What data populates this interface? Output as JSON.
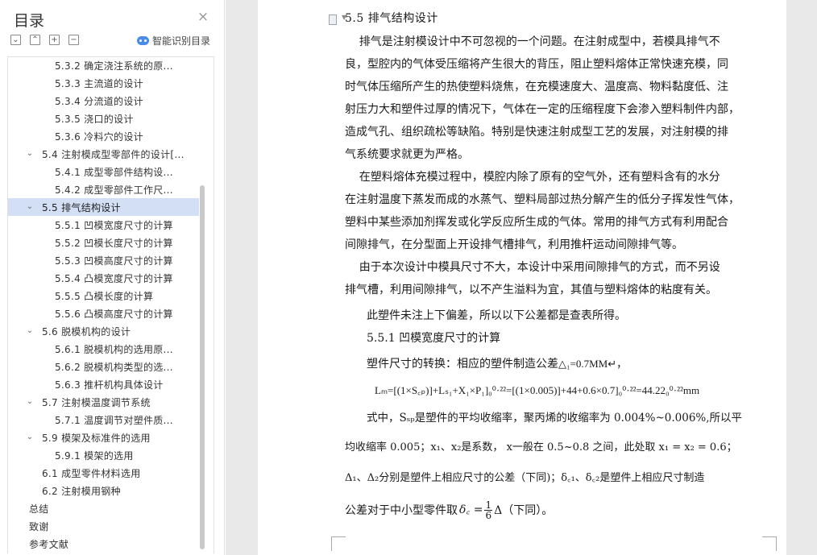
{
  "nav": {
    "title": "目录",
    "close_glyph": "×",
    "toolbar": {
      "collapse_glyph": "⌄",
      "expand_glyph": "⌃",
      "add_glyph": "+",
      "remove_glyph": "−",
      "smart_label": "智能识别目录"
    },
    "items": [
      {
        "label": "5.3.2  确定浇注系统的原...",
        "level": 3,
        "arrow": ""
      },
      {
        "label": "5.3.3  主流道的设计",
        "level": 3,
        "arrow": ""
      },
      {
        "label": "5.3.4  分流道的设计",
        "level": 3,
        "arrow": ""
      },
      {
        "label": "5.3.5  浇口的设计",
        "level": 3,
        "arrow": ""
      },
      {
        "label": "5.3.6  冷料穴的设计",
        "level": 3,
        "arrow": ""
      },
      {
        "label": "5.4  注射模成型零部件的设计[...",
        "level": 2,
        "arrow": "⌄"
      },
      {
        "label": "5.4.1  成型零部件结构设...",
        "level": 3,
        "arrow": ""
      },
      {
        "label": "5.4.2  成型零部件工作尺...",
        "level": 3,
        "arrow": ""
      },
      {
        "label": "5.5  排气结构设计",
        "level": 2,
        "arrow": "⌄",
        "selected": true
      },
      {
        "label": "5.5.1 凹模宽度尺寸的计算",
        "level": 3,
        "arrow": ""
      },
      {
        "label": "5.5.2 凹模长度尺寸的计算",
        "level": 3,
        "arrow": ""
      },
      {
        "label": "5.5.3 凹模高度尺寸的计算",
        "level": 3,
        "arrow": ""
      },
      {
        "label": "5.5.4 凸模宽度尺寸的计算",
        "level": 3,
        "arrow": ""
      },
      {
        "label": "5.5.5 凸模长度的计算",
        "level": 3,
        "arrow": ""
      },
      {
        "label": "5.5.6 凸模高度尺寸的计算",
        "level": 3,
        "arrow": ""
      },
      {
        "label": "5.6  脱模机构的设计",
        "level": 2,
        "arrow": "⌄"
      },
      {
        "label": "5.6.1  脱模机构的选用原...",
        "level": 3,
        "arrow": ""
      },
      {
        "label": "5.6.2  脱模机构类型的选...",
        "level": 3,
        "arrow": ""
      },
      {
        "label": "5.6.3  推杆机构具体设计",
        "level": 3,
        "arrow": ""
      },
      {
        "label": "5.7  注射模温度调节系统",
        "level": 2,
        "arrow": "⌄"
      },
      {
        "label": "5.7.1  温度调节对塑件质...",
        "level": 3,
        "arrow": ""
      },
      {
        "label": "5.9  模架及标准件的选用",
        "level": 2,
        "arrow": "⌄"
      },
      {
        "label": "5.9.1  模架的选用",
        "level": 3,
        "arrow": ""
      },
      {
        "label": "6.1  成型零件材料选用",
        "level": 2,
        "arrow": ""
      },
      {
        "label": "6.2  注射模用钢种",
        "level": 2,
        "arrow": ""
      },
      {
        "label": "总结",
        "level": 1,
        "arrow": ""
      },
      {
        "label": "致谢",
        "level": 1,
        "arrow": ""
      },
      {
        "label": "参考文献",
        "level": 1,
        "arrow": ""
      }
    ]
  },
  "doc": {
    "heading": "5.5  排气结构设计",
    "lines": [
      "    排气是注射模设计中不可忽视的一个问题。在注射成型中，若模具排气不",
      "良，型腔内的气体受压缩将产生很大的背压，阻止塑料熔体正常快速充模，同",
      "时气体压缩所产生的热使塑料烧焦，在充模速度大、温度高、物料黏度低、注",
      "射压力大和塑件过厚的情况下，气体在一定的压缩程度下会渗入塑料制件内部，",
      "造成气孔、组织疏松等缺陷。特别是快速注射成型工艺的发展，对注射模的排",
      "气系统要求就更为严格。",
      "    在塑料熔体充模过程中，模腔内除了原有的空气外，还有塑料含有的水分",
      "在注射温度下蒸发而成的水蒸气、塑料局部过热分解产生的低分子挥发性气体，",
      "塑料中某些添加剂挥发或化学反应所生成的气体。常用的排气方式有利用配合",
      "间隙排气，在分型面上开设排气槽排气，利用推杆运动间隙排气等。",
      "    由于本次设计中模具尺寸不大，本设计中采用间隙排气的方式，而不另设",
      "排气槽，利用间隙排气，以不产生溢料为宜，其值与塑料熔体的粘度有关。"
    ],
    "note": "此塑件未注上下偏差，所以以下公差都是查表所得。",
    "subheading": "5.5.1 凹模宽度尺寸的计算",
    "conversion_prefix": "塑件尺寸的转换：相应的塑件制造公差",
    "conversion_value": "△₁=0.7MM↵，",
    "formula": "Lₘ=[(1×S꜀ₚ)]+Lₛ₁+X₁×P₁]₀⁰·²²=[(1×0.005)]+44+0.6×0.7]₀⁰·²²=44.22₀⁰·²²mm",
    "para2_line1": "式中，Sₛₚ是塑件的平均收缩率，聚丙烯的收缩率为 0.004%~0.006%,所以平",
    "para2_line2": "均收缩率 0.005；x₁、x₂是系数，  x一般在 0.5~0.8 之间，此处取 x₁ = x₂ = 0.6；",
    "para2_line3": "Δ₁、Δ₂分别是塑件上相应尺寸的公差（下同)；δ꜀₁、δ꜀₂是塑件上相应尺寸制造",
    "para2_line4_a": "公差对于中小型零件取",
    "para2_line4_b": "δ꜀ = ",
    "para2_line4_frac_num": "1",
    "para2_line4_frac_den": "6",
    "para2_line4_c": "Δ（下同）。"
  }
}
